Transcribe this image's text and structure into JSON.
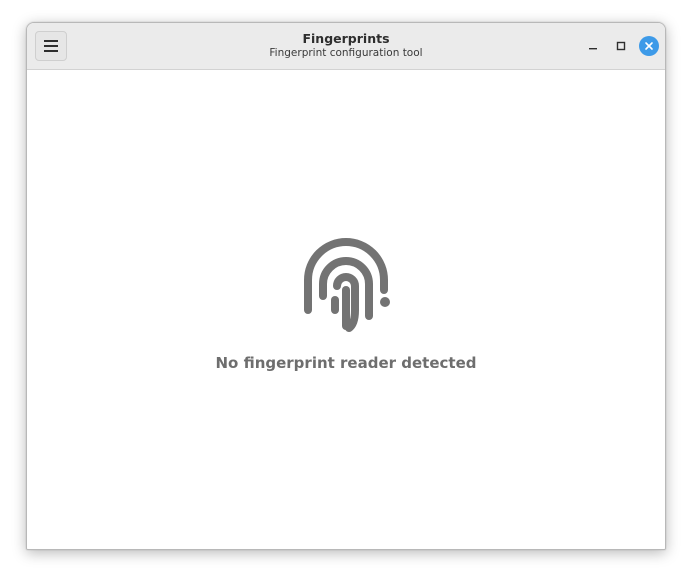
{
  "window": {
    "title": "Fingerprints",
    "subtitle": "Fingerprint configuration tool"
  },
  "header": {
    "menu_icon": "hamburger-menu-icon",
    "controls": {
      "minimize_icon": "minimize-icon",
      "maximize_icon": "maximize-icon",
      "close_icon": "close-icon"
    },
    "close_color": "#3d9ae8"
  },
  "main": {
    "icon": "fingerprint-icon",
    "icon_color": "#737373",
    "status": "No fingerprint reader detected"
  }
}
